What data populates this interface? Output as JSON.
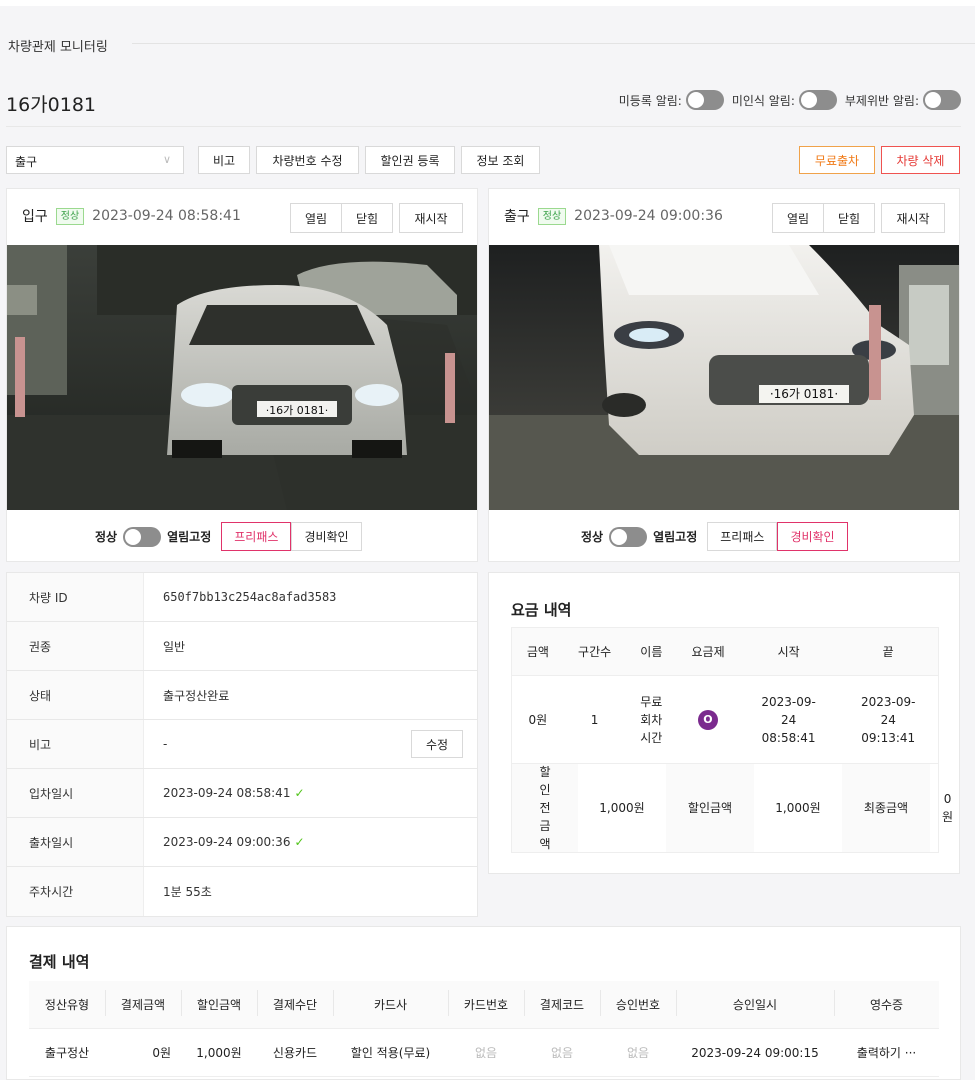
{
  "page": {
    "section_title": "차량관제 모니터링",
    "plate": "16가0181"
  },
  "alerts": [
    {
      "label": "미등록 알림:"
    },
    {
      "label": "미인식 알림:"
    },
    {
      "label": "부제위반 알림:"
    }
  ],
  "toolbar": {
    "direction_value": "출구",
    "buttons": [
      "비고",
      "차량번호 수정",
      "할인권 등록",
      "정보 조회"
    ],
    "free_exit": "무료출차",
    "delete_vehicle": "차량 삭제"
  },
  "gates": [
    {
      "name": "입구",
      "status": "정상",
      "time": "2023-09-24 08:58:41",
      "buttons": [
        "열림",
        "닫힘",
        "재시작"
      ],
      "mode_label": "정상",
      "fix_label": "열림고정",
      "seg": [
        "프리패스",
        "경비확인"
      ],
      "active_seg": 0,
      "plate_text": "·16가 0181·"
    },
    {
      "name": "출구",
      "status": "정상",
      "time": "2023-09-24 09:00:36",
      "buttons": [
        "열림",
        "닫힘",
        "재시작"
      ],
      "mode_label": "정상",
      "fix_label": "열림고정",
      "seg": [
        "프리패스",
        "경비확인"
      ],
      "active_seg": 1,
      "plate_text": "·16가 0181·"
    }
  ],
  "info": [
    {
      "k": "차량 ID",
      "v": "650f7bb13c254ac8afad3583"
    },
    {
      "k": "권종",
      "v": "일반"
    },
    {
      "k": "상태",
      "v": "출구정산완료"
    },
    {
      "k": "비고",
      "v": "-",
      "action": "수정"
    },
    {
      "k": "입차일시",
      "v": "2023-09-24 08:58:41"
    },
    {
      "k": "출차일시",
      "v": "2023-09-24 09:00:36"
    },
    {
      "k": "주차시간",
      "v": "1분 55초"
    }
  ],
  "fees": {
    "title": "요금 내역",
    "headers": [
      "금액",
      "구간수",
      "이름",
      "요금제",
      "시작",
      "끝"
    ],
    "row": {
      "amount": "0원",
      "segments": "1",
      "name": "무료 회차 시간",
      "plan_badge": "O",
      "start": "2023-09-24 08:58:41",
      "end": "2023-09-24 09:13:41"
    },
    "discount": {
      "pre_label": "할인 전 금액",
      "pre_value": "1,000원",
      "disc_label": "할인금액",
      "disc_value": "1,000원",
      "final_label": "최종금액",
      "final_value": "0원"
    }
  },
  "payments": {
    "title": "결제 내역",
    "headers": [
      "정산유형",
      "결제금액",
      "할인금액",
      "결제수단",
      "카드사",
      "카드번호",
      "결제코드",
      "승인번호",
      "승인일시",
      "영수증"
    ],
    "rows": [
      {
        "type": "출구정산",
        "amount": "0원",
        "discount": "1,000원",
        "method": "신용카드",
        "card_co": "할인 적용(무료)",
        "card_no": "없음",
        "code": "없음",
        "approval": "없음",
        "approved_at": "2023-09-24 09:00:15",
        "receipt": "출력하기 ···"
      }
    ]
  }
}
